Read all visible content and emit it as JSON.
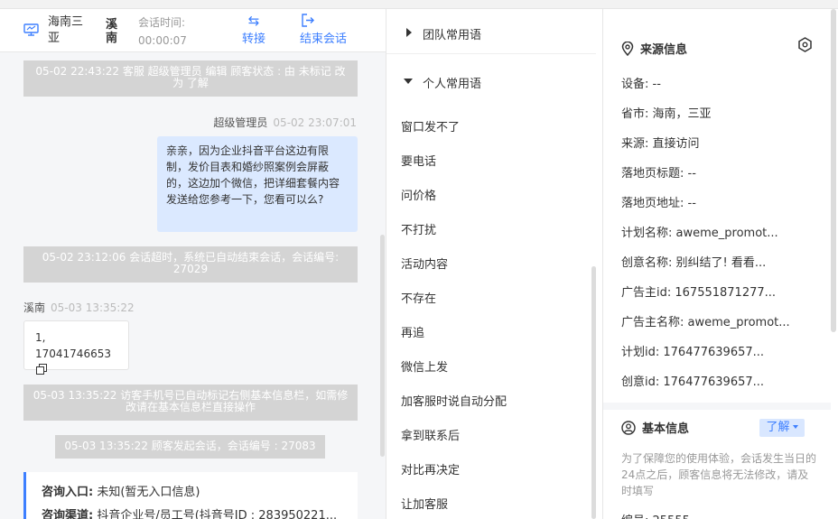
{
  "header": {
    "visitor_name": "海南三亚",
    "agent_name": "溪南",
    "time_label": "会话时间:",
    "time_value": "00:00:07",
    "transfer_label": "转接",
    "end_label": "结束会话"
  },
  "messages": {
    "sys1": "05-02 22:43:22 客服 超级管理员 编辑 顾客状态 : 由 未标记 改为 了解",
    "agent_sender": "超级管理员",
    "agent_time": "05-02 23:07:01",
    "agent_text": "亲亲，因为企业抖音平台这边有限制，发价目表和婚纱照案例会屏蔽的，这边加个微信，把详细套餐内容发送给您参考一下，您看可以么?",
    "sys2": "05-02 23:12:06 会话超时，系统已自动结束会话，会话编号: 27029",
    "visitor_sender": "溪南",
    "visitor_time": "05-03 13:35:22",
    "visitor_line1": "1,",
    "visitor_line2": "17041746653",
    "sys3": "05-03 13:35:22 访客手机号已自动标记右侧基本信息栏，如需修改请在基本信息栏直接操作",
    "sys4": "05-03 13:35:22 顾客发起会话，会话编号 : 27083",
    "card_entry_label": "咨询入口:",
    "card_entry_value": " 未知(暂无入口信息)",
    "card_channel_label": "咨询渠道:",
    "card_channel_value": " 抖音企业号/员工号(抖音号ID : 283950221..."
  },
  "phrases": {
    "team_group": "团队常用语",
    "personal_group": "个人常用语",
    "items": [
      "窗口发不了",
      "要电话",
      "问价格",
      "不打扰",
      "活动内容",
      "不存在",
      "再追",
      "微信上发",
      "加客服时说自动分配",
      "拿到联系后",
      "对比再决定",
      "让加客服"
    ]
  },
  "source_info": {
    "title": "来源信息",
    "fields": [
      "设备:  --",
      "省市:  海南，三亚",
      "来源:  直接访问",
      "落地页标题:  --",
      "落地页地址:  --",
      "计划名称:  aweme_promot...",
      "创意名称:  别纠结了! 看看...",
      "广告主id:  167551871277...",
      "广告主名称:  aweme_promot...",
      "计划id:  176477639657...",
      "创意id:  176477639657..."
    ]
  },
  "basic_info": {
    "title": "基本信息",
    "learn_label": "了解",
    "notice": "为了保障您的使用体验，会话发生当日的24点之后，顾客信息将无法修改，请及时填写",
    "partial_field": "编号:  25555"
  },
  "colors": {
    "accent": "#3d7fff",
    "system_bubble": "#d4d4d4",
    "agent_bubble": "#dbe9ff"
  }
}
